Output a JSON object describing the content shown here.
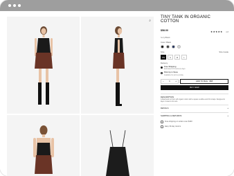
{
  "window": {
    "controls": [
      "dot",
      "dot",
      "dot"
    ]
  },
  "gallery": {
    "zoom_icon": "zoom-in-icon",
    "zoom_glyph": "⌕"
  },
  "product": {
    "title": "TINY TANK IN ORGANIC COTTON",
    "price": "$58.00",
    "stars": "★★★★★",
    "review_text": "4.8",
    "sub": "Ivory/Black",
    "color_label": "Color: Black",
    "colors": [
      "#111111",
      "#3b3b3b",
      "#1f2f5a",
      "#d9d9d9"
    ],
    "size_label": "Size",
    "size_guide": "Size Guide",
    "sizes": [
      "XS",
      "S",
      "M",
      "L"
    ],
    "size_selected": "XS",
    "shipping_label": "Delivery",
    "ship_option1": "Free Shipping",
    "ship_option1_sub": "Estimated 3-5 business days",
    "ship_option2": "Pick Up in Store",
    "ship_option2_sub": "Available for pick up today",
    "qty_minus": "−",
    "qty_value": "1",
    "qty_plus": "+",
    "add_to_bag": "ADD TO BAG · $58",
    "buy_now": "BUY NOW",
    "desc_heading": "DESCRIPTION",
    "desc_text": "A fitted tank cut from soft organic cotton with a square neckline and thin straps. Designed to layer or wear on its own.",
    "acc_details": "DETAILS",
    "acc_shipping": "SHIPPING & RETURNS",
    "acc_sign": "+",
    "sect1": "Free shipping on orders over $100",
    "sect2": "Easy 30-day returns"
  }
}
